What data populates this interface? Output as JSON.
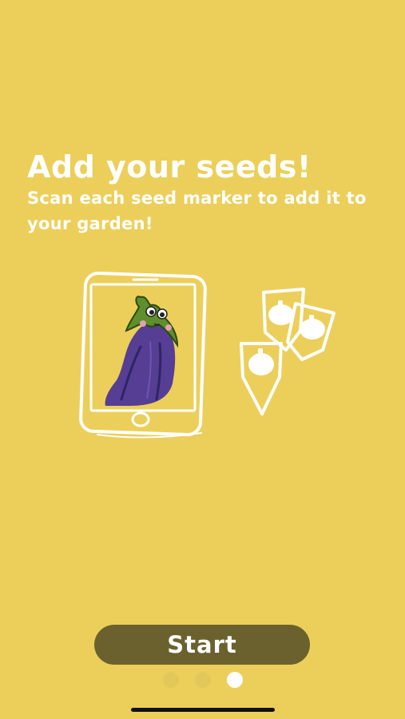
{
  "onboarding": {
    "title": "Add your seeds!",
    "subtitle": "Scan each seed marker to add it to your garden!",
    "illustration": {
      "icons": [
        "phone-icon",
        "eggplant-icon",
        "seed-marker-icon"
      ]
    },
    "start_label": "Start",
    "pager": {
      "page_count": 3,
      "current_page": 3
    }
  },
  "colors": {
    "background": "#ECCF5A",
    "text": "#FFFFFF",
    "button": "#6B612F",
    "dot_inactive": "#E2C85B",
    "dot_active": "#FFFFFF",
    "eggplant": "#553E94",
    "leaf": "#5E8F2C"
  }
}
